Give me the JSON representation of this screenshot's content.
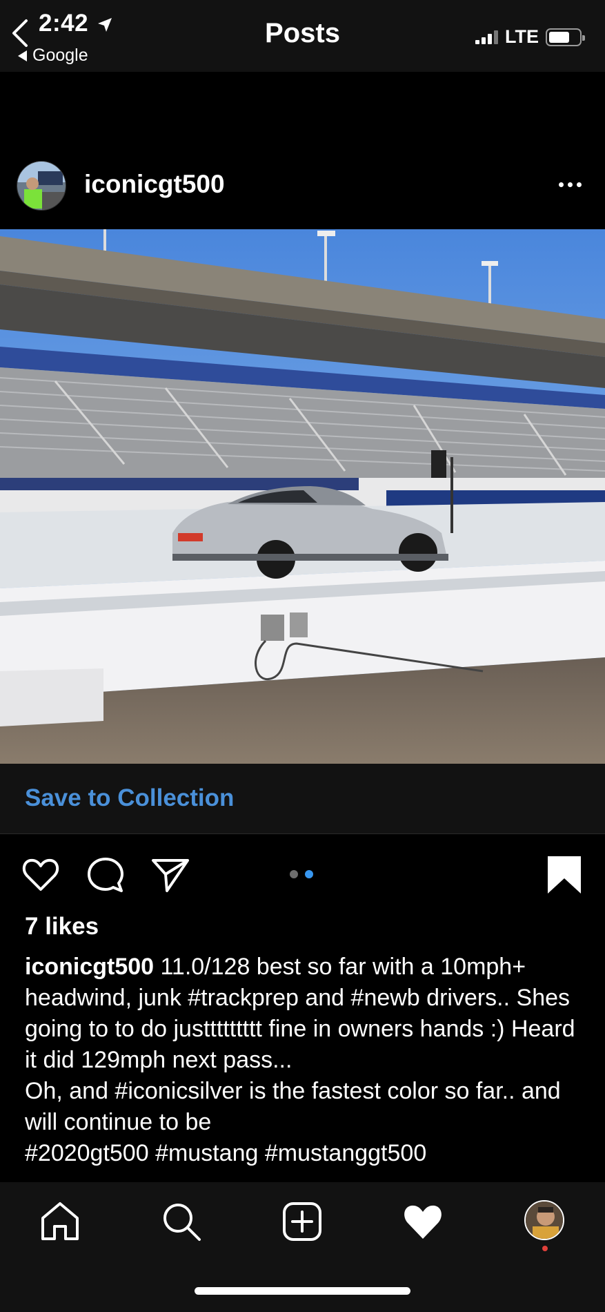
{
  "status_bar": {
    "time": "2:42",
    "back_app": "Google",
    "network": "LTE",
    "icons": [
      "location-arrow-icon",
      "signal-icon",
      "battery-icon"
    ]
  },
  "nav": {
    "title": "Posts",
    "back_icon": "chevron-left-icon"
  },
  "post": {
    "username": "iconicgt500",
    "more_icon": "more-icon",
    "media_description_icon": "post-photo",
    "save_to_collection": "Save to Collection",
    "carousel": {
      "count": 2,
      "active_index": 1
    },
    "likes": "7 likes",
    "caption_user": "iconicgt500",
    "caption_text": " 11.0/128 best so far with a 10mph+ headwind, junk #trackprep and #newb drivers.. Shes going to to do justtttttttt fine in owners hands :) Heard it did 129mph next pass...",
    "caption_line2": "Oh, and #iconicsilver is the fastest color so far.. and will continue to be",
    "caption_line3": "#2020gt500 #mustang #mustanggt500"
  },
  "tabs": [
    {
      "name": "home",
      "icon": "home-icon"
    },
    {
      "name": "search",
      "icon": "search-icon"
    },
    {
      "name": "new-post",
      "icon": "add-post-icon"
    },
    {
      "name": "activity",
      "icon": "heart-filled-icon"
    },
    {
      "name": "profile",
      "icon": "profile-avatar"
    }
  ],
  "colors": {
    "background": "#000000",
    "bars": "#121212",
    "link_blue": "#4a90d9",
    "carousel_active": "#3897f0",
    "carousel_inactive": "#6e6e6e",
    "notification_dot": "#e0403a"
  }
}
